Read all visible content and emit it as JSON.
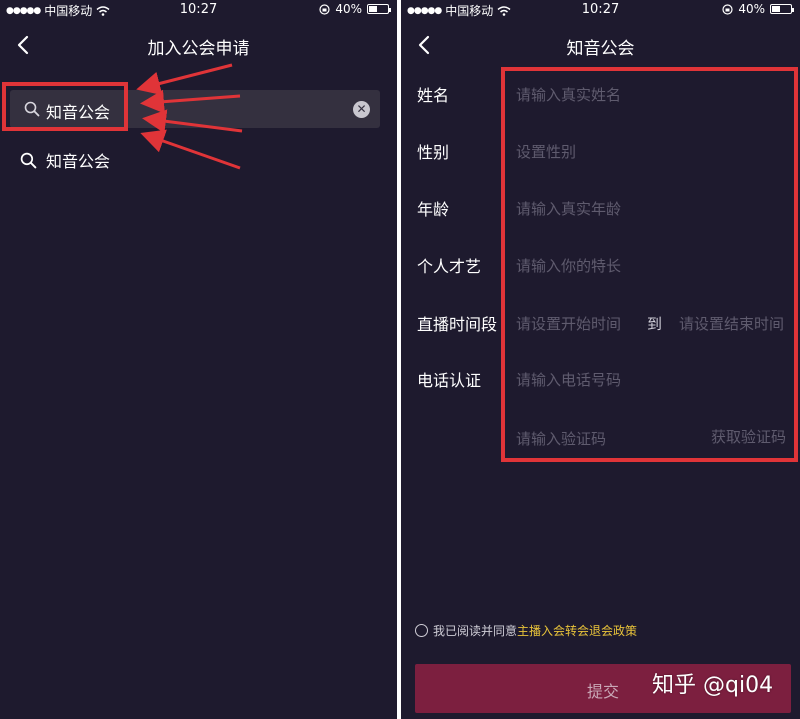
{
  "status": {
    "carrier": "中国移动",
    "time": "10:27",
    "battery": "40%",
    "battery_level": 0.4
  },
  "left": {
    "nav_title": "加入公会申请",
    "search_value": "知音公会",
    "suggestion": "知音公会"
  },
  "right": {
    "nav_title": "知音公会",
    "form": {
      "name_label": "姓名",
      "name_placeholder": "请输入真实姓名",
      "gender_label": "性别",
      "gender_placeholder": "设置性别",
      "age_label": "年龄",
      "age_placeholder": "请输入真实年龄",
      "talent_label": "个人才艺",
      "talent_placeholder": "请输入你的特长",
      "time_label": "直播时间段",
      "start_placeholder": "请设置开始时间",
      "to_text": "到",
      "end_placeholder": "请设置结束时间",
      "phone_label": "电话认证",
      "phone_placeholder": "请输入电话号码",
      "code_placeholder": "请输入验证码",
      "get_code": "获取验证码"
    },
    "agree_text": "我已阅读并同意",
    "agree_link": "主播入会转会退会政策",
    "submit_label": "提交"
  },
  "watermark": "知乎 @qi04",
  "colors": {
    "background": "#1e1a2e",
    "highlight": "#e03438",
    "submit": "#7c1f3f",
    "policy_link": "#e8c33a"
  }
}
